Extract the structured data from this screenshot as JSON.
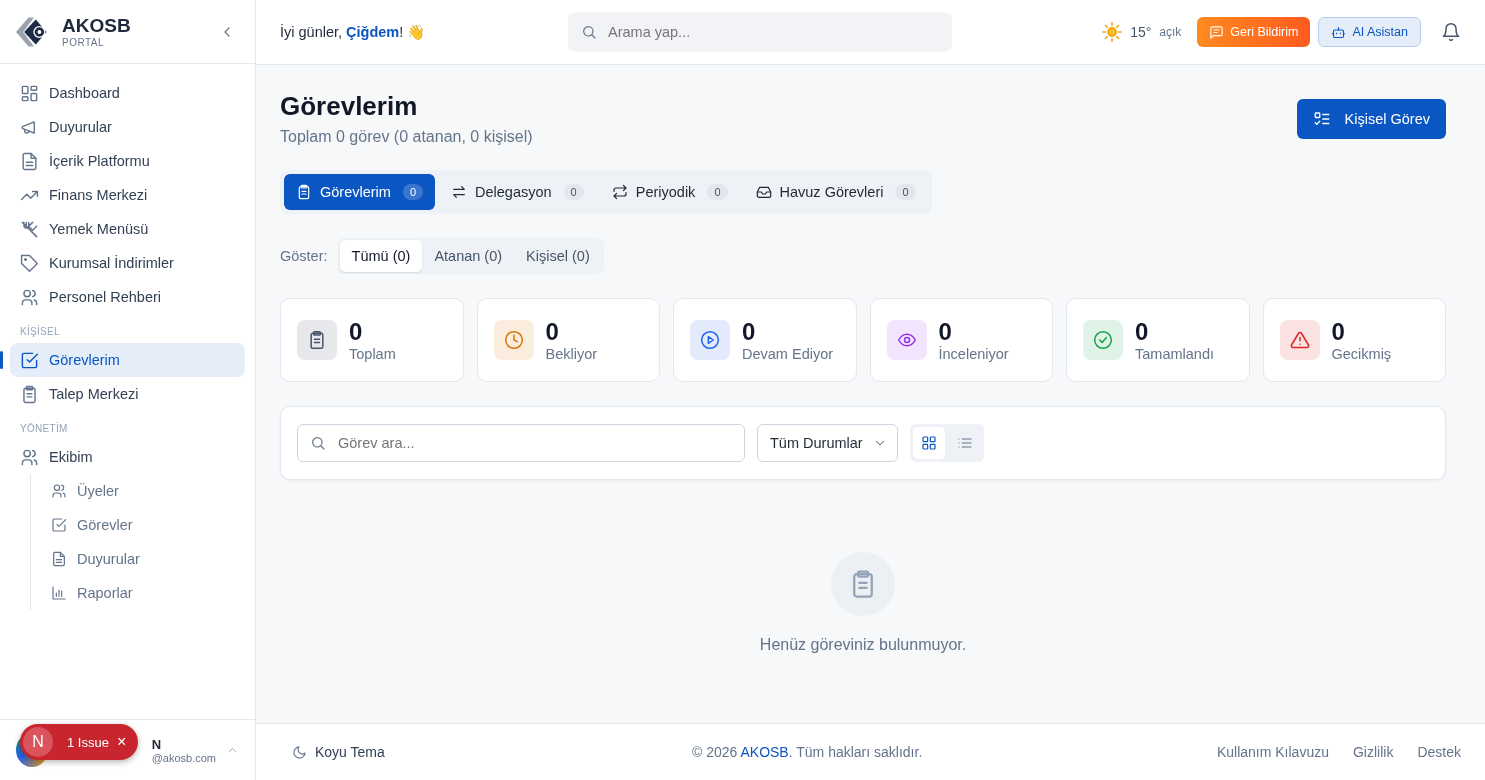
{
  "brand": {
    "name": "AKOSB",
    "subtitle": "PORTAL"
  },
  "sidebar": {
    "sections": [
      {
        "items": [
          {
            "label": "Dashboard",
            "selected": false
          },
          {
            "label": "Duyurular",
            "selected": false
          },
          {
            "label": "İçerik Platformu",
            "selected": false
          },
          {
            "label": "Finans Merkezi",
            "selected": false
          },
          {
            "label": "Yemek Menüsü",
            "selected": false
          },
          {
            "label": "Kurumsal İndirimler",
            "selected": false
          },
          {
            "label": "Personel Rehberi",
            "selected": false
          }
        ]
      },
      {
        "title": "KİŞİSEL",
        "items": [
          {
            "label": "Görevlerim",
            "selected": true
          },
          {
            "label": "Talep Merkezi",
            "selected": false
          }
        ]
      },
      {
        "title": "YÖNETİM",
        "items": [
          {
            "label": "Ekibim",
            "selected": false,
            "children": [
              {
                "label": "Üyeler",
                "selected": false
              },
              {
                "label": "Görevler",
                "selected": false
              },
              {
                "label": "Duyurular",
                "selected": false
              },
              {
                "label": "Raporlar",
                "selected": false
              }
            ]
          }
        ]
      }
    ]
  },
  "user": {
    "name": "N",
    "email": "@akosb.com"
  },
  "issue_badge": {
    "letter": "N",
    "label": "1 Issue",
    "close": "×"
  },
  "header": {
    "greeting": "İyi günler, ",
    "user_name": "Çiğdem",
    "greeting_end": "! 👋",
    "search": {
      "placeholder": "Arama yap..."
    },
    "weather": {
      "temp": "15°",
      "condition": "açık"
    },
    "feedback": "Geri Bildirim",
    "assistant": "AI Asistan"
  },
  "page": {
    "title": "Görevlerim",
    "subtitle": "Toplam 0 görev (0 atanan, 0 kişisel)",
    "new_button": "Kişisel Görev"
  },
  "tabs": [
    {
      "label": "Görevlerim",
      "count": "0",
      "selected": true
    },
    {
      "label": "Delegasyon",
      "count": "0",
      "selected": false
    },
    {
      "label": "Periyodik",
      "count": "0",
      "selected": false
    },
    {
      "label": "Havuz Görevleri",
      "count": "0",
      "selected": false
    }
  ],
  "filter": {
    "label": "Göster:",
    "options": [
      {
        "label": "Tümü (0)",
        "selected": true
      },
      {
        "label": "Atanan (0)",
        "selected": false
      },
      {
        "label": "Kişisel (0)",
        "selected": false
      }
    ]
  },
  "stats": [
    {
      "value": "0",
      "label": "Toplam",
      "color": "#475569"
    },
    {
      "value": "0",
      "label": "Bekliyor",
      "color": "#d97706"
    },
    {
      "value": "0",
      "label": "Devam Ediyor",
      "color": "#2563eb"
    },
    {
      "value": "0",
      "label": "İnceleniyor",
      "color": "#9333ea"
    },
    {
      "value": "0",
      "label": "Tamamlandı",
      "color": "#16a34a"
    },
    {
      "value": "0",
      "label": "Gecikmiş",
      "color": "#dc2626"
    }
  ],
  "toolbar": {
    "search": {
      "placeholder": "Görev ara..."
    },
    "status": "Tüm Durumlar",
    "view_modes": [
      {
        "selected": true
      },
      {
        "selected": false
      }
    ]
  },
  "empty": {
    "message": "Henüz göreviniz bulunmuyor."
  },
  "footer": {
    "theme": "Koyu Tema",
    "copyright_pre": "© 2026 ",
    "copyright_brand": "AKOSB",
    "copyright_post": ". Tüm hakları saklıdır.",
    "links": [
      "Kullanım Kılavuzu",
      "Gizlilik",
      "Destek"
    ]
  }
}
